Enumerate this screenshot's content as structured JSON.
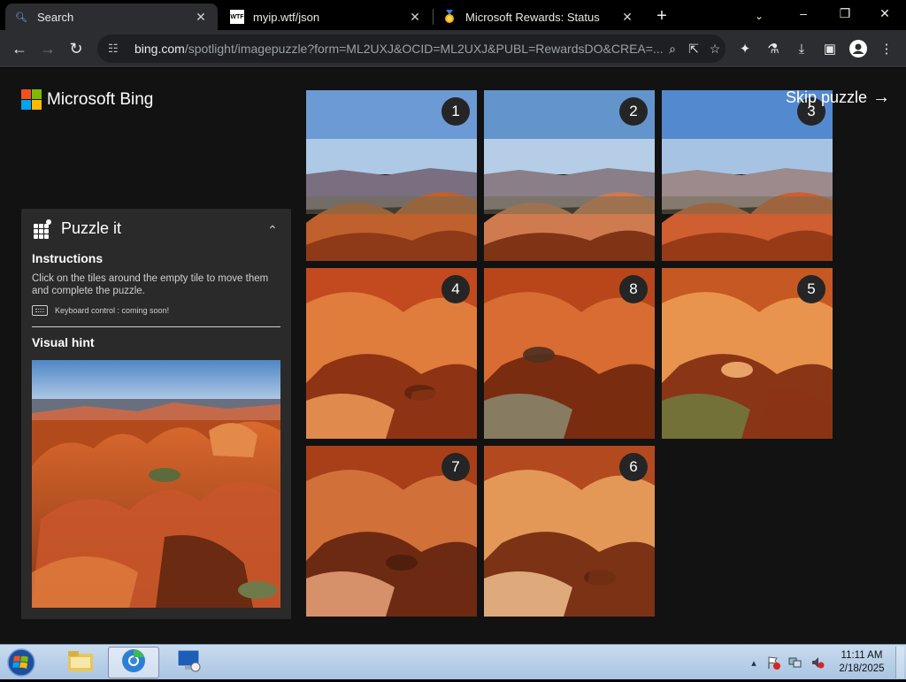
{
  "tabs": [
    {
      "title": "Search",
      "icon": "search-icon",
      "active": true
    },
    {
      "title": "myip.wtf/json",
      "icon": "wtf-favicon",
      "favicon_text": "WTF",
      "active": false
    },
    {
      "title": "Microsoft Rewards: Status",
      "icon": "rewards-medal-icon",
      "active": false
    }
  ],
  "address": {
    "host": "bing.com",
    "path": "/spotlight/imagepuzzle?form=ML2UXJ&OCID=ML2UXJ&PUBL=RewardsDO&CREA=..."
  },
  "brand": {
    "name": "Microsoft Bing"
  },
  "panel": {
    "title": "Puzzle it",
    "instructions_heading": "Instructions",
    "instructions_text": "Click on the tiles around the empty tile to move them and complete the puzzle.",
    "keyboard_note": "Keyboard control : coming soon!",
    "hint_heading": "Visual hint"
  },
  "skip_label": "Skip puzzle",
  "tiles": [
    {
      "number": "1",
      "row": 0,
      "col": 0
    },
    {
      "number": "2",
      "row": 0,
      "col": 1
    },
    {
      "number": "3",
      "row": 0,
      "col": 2
    },
    {
      "number": "4",
      "row": 1,
      "col": 0
    },
    {
      "number": "8",
      "row": 1,
      "col": 1
    },
    {
      "number": "5",
      "row": 1,
      "col": 2
    },
    {
      "number": "7",
      "row": 2,
      "col": 0
    },
    {
      "number": "6",
      "row": 2,
      "col": 1
    }
  ],
  "taskbar": {
    "time": "11:11 AM",
    "date": "2/18/2025"
  },
  "colors": {
    "ms_red": "#f25022",
    "ms_green": "#7fba00",
    "ms_blue": "#00a4ef",
    "ms_yellow": "#ffb900"
  }
}
